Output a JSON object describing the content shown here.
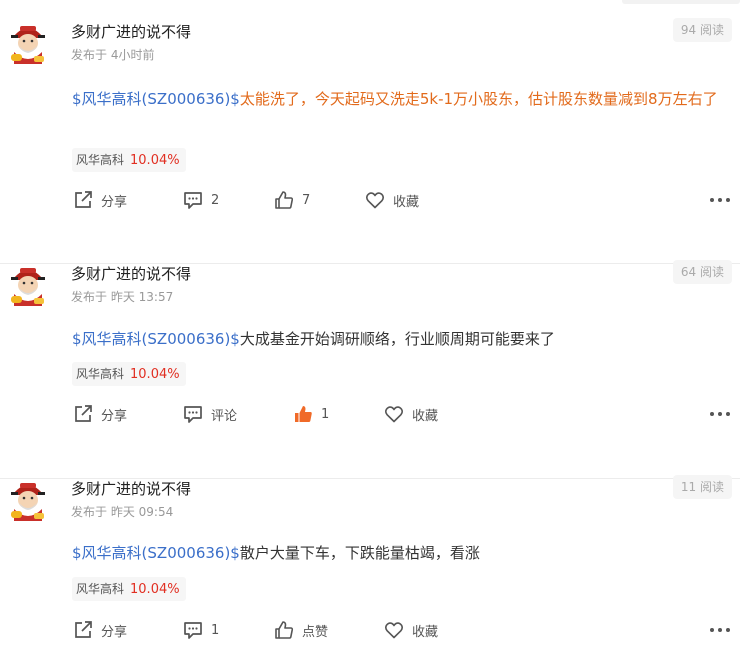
{
  "posts": [
    {
      "author": "多财广进的说不得",
      "time": "发布于 4小时前",
      "reads": "94 阅读",
      "stock_link": "$风华高科(SZ000636)$",
      "text": "太能洗了，今天起码又洗走5k-1万小股东，估计股东数量减到8万左右了",
      "text_highlight": true,
      "tag_name": "风华高科",
      "tag_change": "10.04%",
      "share_label": "分享",
      "comment_label": "2",
      "like_label": "7",
      "like_active": false,
      "favorite_label": "收藏"
    },
    {
      "author": "多财广进的说不得",
      "time": "发布于 昨天 13:57",
      "reads": "64 阅读",
      "stock_link": "$风华高科(SZ000636)$",
      "text": "大成基金开始调研顺络，行业顺周期可能要来了",
      "text_highlight": false,
      "tag_name": "风华高科",
      "tag_change": "10.04%",
      "share_label": "分享",
      "comment_label": "评论",
      "like_label": "1",
      "like_active": true,
      "favorite_label": "收藏"
    },
    {
      "author": "多财广进的说不得",
      "time": "发布于 昨天 09:54",
      "reads": "11 阅读",
      "stock_link": "$风华高科(SZ000636)$",
      "text": "散户大量下车，下跌能量枯竭，看涨",
      "text_highlight": false,
      "tag_name": "风华高科",
      "tag_change": "10.04%",
      "share_label": "分享",
      "comment_label": "1",
      "like_label": "点赞",
      "like_active": false,
      "favorite_label": "收藏"
    }
  ],
  "colors": {
    "stock_link": "#3b6fc9",
    "highlight_text": "#e26a1b",
    "change_up": "#e12f22",
    "like_active": "#f06a28"
  },
  "icons": {
    "share": "share-icon",
    "comment": "comment-icon",
    "like": "thumbs-up-icon",
    "favorite": "heart-icon",
    "more": "more-dots-icon",
    "avatar": "fortune-god-avatar"
  }
}
